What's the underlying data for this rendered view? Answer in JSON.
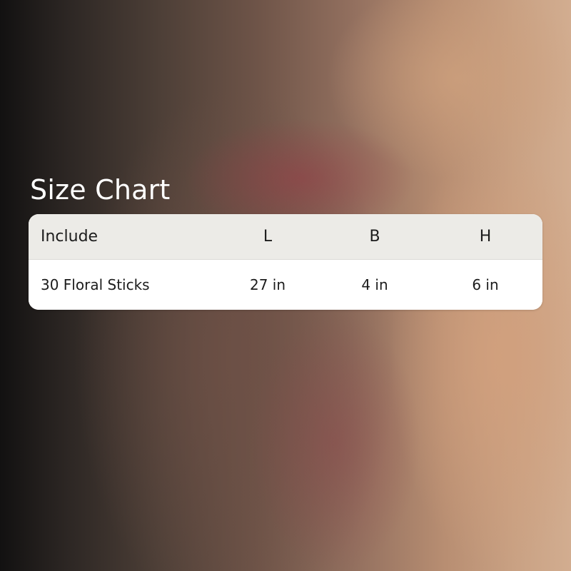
{
  "title": "Size Chart",
  "table": {
    "headers": [
      "Include",
      "L",
      "B",
      "H"
    ],
    "rows": [
      [
        "30 Floral Sticks",
        "27 in",
        "4 in",
        "6 in"
      ]
    ]
  },
  "colors": {
    "title_text": "#ffffff",
    "header_bg": "#ecebe7",
    "row_bg": "#ffffff",
    "cell_text": "#1c1c1c"
  }
}
